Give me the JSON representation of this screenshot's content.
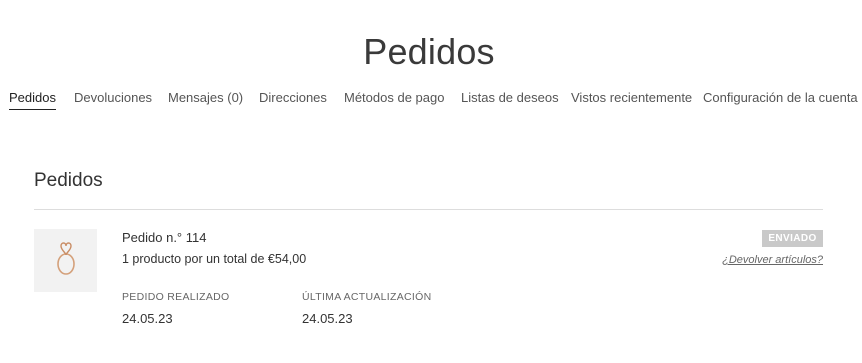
{
  "page": {
    "title": "Pedidos"
  },
  "nav": {
    "tabs": [
      {
        "label": "Pedidos"
      },
      {
        "label": "Devoluciones"
      },
      {
        "label": "Mensajes (0)"
      },
      {
        "label": "Direcciones"
      },
      {
        "label": "Métodos de pago"
      },
      {
        "label": "Listas de deseos"
      },
      {
        "label": "Vistos recientemente"
      },
      {
        "label": "Configuración de la cuenta"
      }
    ],
    "active_tab": "Pedidos"
  },
  "section": {
    "title": "Pedidos"
  },
  "orders": [
    {
      "title": "Pedido n.° 114",
      "summary": "1 producto por un total de €54,00",
      "status": "ENVIADO",
      "return_link": "¿Devolver artículos?",
      "placed_label": "PEDIDO REALIZADO",
      "placed_value": "24.05.23",
      "updated_label": "ÚLTIMA ACTUALIZACIÓN",
      "updated_value": "24.05.23",
      "thumbnail_icon": "ring-icon",
      "status_color": "#c9c9c9"
    }
  ]
}
